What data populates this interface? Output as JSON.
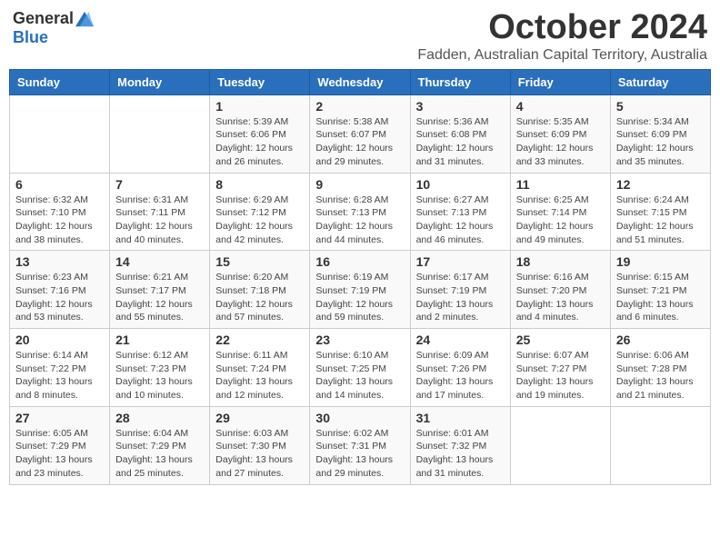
{
  "logo": {
    "general": "General",
    "blue": "Blue"
  },
  "title": "October 2024",
  "location": "Fadden, Australian Capital Territory, Australia",
  "days_of_week": [
    "Sunday",
    "Monday",
    "Tuesday",
    "Wednesday",
    "Thursday",
    "Friday",
    "Saturday"
  ],
  "weeks": [
    [
      {
        "day": "",
        "info": ""
      },
      {
        "day": "",
        "info": ""
      },
      {
        "day": "1",
        "info": "Sunrise: 5:39 AM\nSunset: 6:06 PM\nDaylight: 12 hours and 26 minutes."
      },
      {
        "day": "2",
        "info": "Sunrise: 5:38 AM\nSunset: 6:07 PM\nDaylight: 12 hours and 29 minutes."
      },
      {
        "day": "3",
        "info": "Sunrise: 5:36 AM\nSunset: 6:08 PM\nDaylight: 12 hours and 31 minutes."
      },
      {
        "day": "4",
        "info": "Sunrise: 5:35 AM\nSunset: 6:09 PM\nDaylight: 12 hours and 33 minutes."
      },
      {
        "day": "5",
        "info": "Sunrise: 5:34 AM\nSunset: 6:09 PM\nDaylight: 12 hours and 35 minutes."
      }
    ],
    [
      {
        "day": "6",
        "info": "Sunrise: 6:32 AM\nSunset: 7:10 PM\nDaylight: 12 hours and 38 minutes."
      },
      {
        "day": "7",
        "info": "Sunrise: 6:31 AM\nSunset: 7:11 PM\nDaylight: 12 hours and 40 minutes."
      },
      {
        "day": "8",
        "info": "Sunrise: 6:29 AM\nSunset: 7:12 PM\nDaylight: 12 hours and 42 minutes."
      },
      {
        "day": "9",
        "info": "Sunrise: 6:28 AM\nSunset: 7:13 PM\nDaylight: 12 hours and 44 minutes."
      },
      {
        "day": "10",
        "info": "Sunrise: 6:27 AM\nSunset: 7:13 PM\nDaylight: 12 hours and 46 minutes."
      },
      {
        "day": "11",
        "info": "Sunrise: 6:25 AM\nSunset: 7:14 PM\nDaylight: 12 hours and 49 minutes."
      },
      {
        "day": "12",
        "info": "Sunrise: 6:24 AM\nSunset: 7:15 PM\nDaylight: 12 hours and 51 minutes."
      }
    ],
    [
      {
        "day": "13",
        "info": "Sunrise: 6:23 AM\nSunset: 7:16 PM\nDaylight: 12 hours and 53 minutes."
      },
      {
        "day": "14",
        "info": "Sunrise: 6:21 AM\nSunset: 7:17 PM\nDaylight: 12 hours and 55 minutes."
      },
      {
        "day": "15",
        "info": "Sunrise: 6:20 AM\nSunset: 7:18 PM\nDaylight: 12 hours and 57 minutes."
      },
      {
        "day": "16",
        "info": "Sunrise: 6:19 AM\nSunset: 7:19 PM\nDaylight: 12 hours and 59 minutes."
      },
      {
        "day": "17",
        "info": "Sunrise: 6:17 AM\nSunset: 7:19 PM\nDaylight: 13 hours and 2 minutes."
      },
      {
        "day": "18",
        "info": "Sunrise: 6:16 AM\nSunset: 7:20 PM\nDaylight: 13 hours and 4 minutes."
      },
      {
        "day": "19",
        "info": "Sunrise: 6:15 AM\nSunset: 7:21 PM\nDaylight: 13 hours and 6 minutes."
      }
    ],
    [
      {
        "day": "20",
        "info": "Sunrise: 6:14 AM\nSunset: 7:22 PM\nDaylight: 13 hours and 8 minutes."
      },
      {
        "day": "21",
        "info": "Sunrise: 6:12 AM\nSunset: 7:23 PM\nDaylight: 13 hours and 10 minutes."
      },
      {
        "day": "22",
        "info": "Sunrise: 6:11 AM\nSunset: 7:24 PM\nDaylight: 13 hours and 12 minutes."
      },
      {
        "day": "23",
        "info": "Sunrise: 6:10 AM\nSunset: 7:25 PM\nDaylight: 13 hours and 14 minutes."
      },
      {
        "day": "24",
        "info": "Sunrise: 6:09 AM\nSunset: 7:26 PM\nDaylight: 13 hours and 17 minutes."
      },
      {
        "day": "25",
        "info": "Sunrise: 6:07 AM\nSunset: 7:27 PM\nDaylight: 13 hours and 19 minutes."
      },
      {
        "day": "26",
        "info": "Sunrise: 6:06 AM\nSunset: 7:28 PM\nDaylight: 13 hours and 21 minutes."
      }
    ],
    [
      {
        "day": "27",
        "info": "Sunrise: 6:05 AM\nSunset: 7:29 PM\nDaylight: 13 hours and 23 minutes."
      },
      {
        "day": "28",
        "info": "Sunrise: 6:04 AM\nSunset: 7:29 PM\nDaylight: 13 hours and 25 minutes."
      },
      {
        "day": "29",
        "info": "Sunrise: 6:03 AM\nSunset: 7:30 PM\nDaylight: 13 hours and 27 minutes."
      },
      {
        "day": "30",
        "info": "Sunrise: 6:02 AM\nSunset: 7:31 PM\nDaylight: 13 hours and 29 minutes."
      },
      {
        "day": "31",
        "info": "Sunrise: 6:01 AM\nSunset: 7:32 PM\nDaylight: 13 hours and 31 minutes."
      },
      {
        "day": "",
        "info": ""
      },
      {
        "day": "",
        "info": ""
      }
    ]
  ]
}
